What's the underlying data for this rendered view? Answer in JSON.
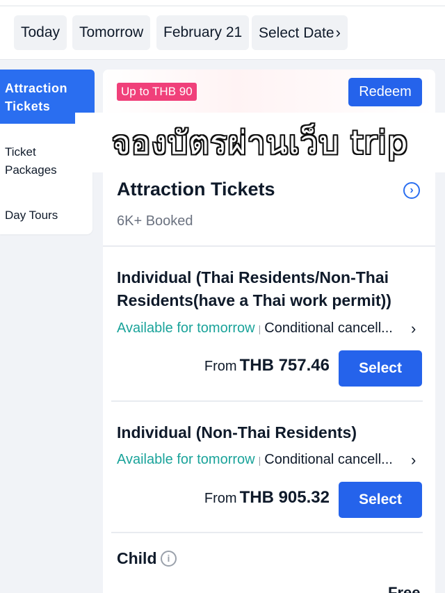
{
  "date_bar": {
    "chips": [
      "Today",
      "Tomorrow",
      "February 21",
      "Select Date"
    ],
    "chevron_icon": "chevron-right-icon"
  },
  "sidebar": {
    "items": [
      {
        "label": "Attraction Tickets",
        "active": true
      },
      {
        "label": "Ticket Packages",
        "active": false
      },
      {
        "label": "Day Tours",
        "active": false
      }
    ]
  },
  "promo": {
    "badge": "Up to THB 90",
    "redeem_label": "Redeem"
  },
  "overlay": {
    "text": "จองบัตรผ่านเว็บ trip"
  },
  "section": {
    "title": "Attraction Tickets",
    "booked": "6K+ Booked",
    "info_icon": "chevron-right-circle-icon"
  },
  "packages": [
    {
      "name": "Individual (Thai Residents/Non-Thai Residents(have a Thai work permit))",
      "availability": "Available for tomorrow",
      "separator": "|",
      "cancellation": "Conditional cancell...",
      "price_prefix": "From",
      "price": "THB 757.46",
      "select_label": "Select"
    },
    {
      "name": "Individual (Non-Thai Residents)",
      "availability": "Available for tomorrow",
      "separator": "|",
      "cancellation": "Conditional cancell...",
      "price_prefix": "From",
      "price": "THB 905.32",
      "select_label": "Select"
    }
  ],
  "child": {
    "title": "Child",
    "info_icon": "info-icon",
    "price_text": "Free"
  },
  "colors": {
    "primary": "#2563eb",
    "sidebar_active": "#2a6ef0",
    "promo_badge": "#f0407a",
    "availability": "#1aa39a"
  }
}
